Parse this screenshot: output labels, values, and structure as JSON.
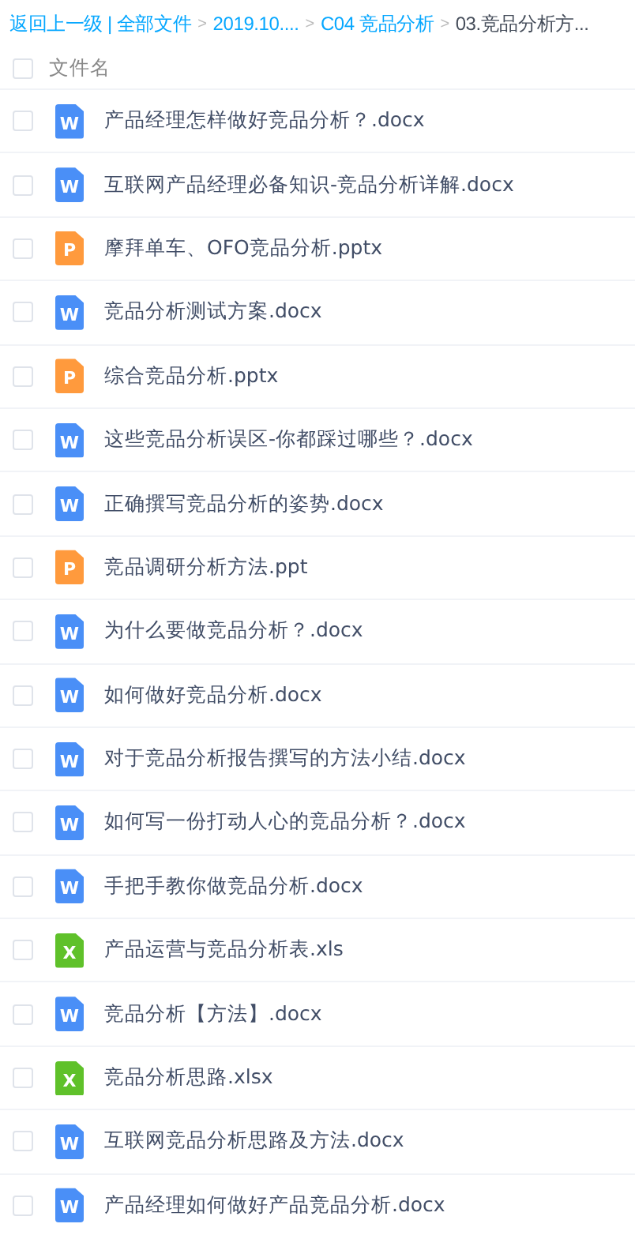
{
  "breadcrumb": [
    {
      "kind": "link",
      "text": "返回上一级"
    },
    {
      "kind": "divider",
      "text": "|"
    },
    {
      "kind": "link",
      "text": "全部文件"
    },
    {
      "kind": "arrow",
      "text": ">"
    },
    {
      "kind": "link",
      "text": "2019.10...."
    },
    {
      "kind": "arrow",
      "text": ">"
    },
    {
      "kind": "link",
      "text": "C04 竞品分析"
    },
    {
      "kind": "arrow",
      "text": ">"
    },
    {
      "kind": "current",
      "text": "03.竞品分析方..."
    }
  ],
  "header": {
    "label": "文件名",
    "checked": false
  },
  "files": [
    {
      "kind": "word",
      "letter": "W",
      "name": "产品经理怎样做好竞品分析？.docx",
      "checked": false
    },
    {
      "kind": "word",
      "letter": "W",
      "name": "互联网产品经理必备知识-竞品分析详解.docx",
      "checked": false
    },
    {
      "kind": "ppt",
      "letter": "P",
      "name": "摩拜单车、OFO竞品分析.pptx",
      "checked": false
    },
    {
      "kind": "word",
      "letter": "W",
      "name": "竞品分析测试方案.docx",
      "checked": false
    },
    {
      "kind": "ppt",
      "letter": "P",
      "name": "综合竞品分析.pptx",
      "checked": false
    },
    {
      "kind": "word",
      "letter": "W",
      "name": "这些竞品分析误区-你都踩过哪些？.docx",
      "checked": false
    },
    {
      "kind": "word",
      "letter": "W",
      "name": "正确撰写竞品分析的姿势.docx",
      "checked": false
    },
    {
      "kind": "ppt",
      "letter": "P",
      "name": "竞品调研分析方法.ppt",
      "checked": false
    },
    {
      "kind": "word",
      "letter": "W",
      "name": "为什么要做竞品分析？.docx",
      "checked": false
    },
    {
      "kind": "word",
      "letter": "W",
      "name": "如何做好竞品分析.docx",
      "checked": false
    },
    {
      "kind": "word",
      "letter": "W",
      "name": "对于竞品分析报告撰写的方法小结.docx",
      "checked": false
    },
    {
      "kind": "word",
      "letter": "W",
      "name": "如何写一份打动人心的竞品分析？.docx",
      "checked": false
    },
    {
      "kind": "word",
      "letter": "W",
      "name": "手把手教你做竞品分析.docx",
      "checked": false
    },
    {
      "kind": "excel",
      "letter": "X",
      "name": "产品运营与竞品分析表.xls",
      "checked": false
    },
    {
      "kind": "word",
      "letter": "W",
      "name": "竞品分析【方法】.docx",
      "checked": false
    },
    {
      "kind": "excel",
      "letter": "X",
      "name": "竞品分析思路.xlsx",
      "checked": false
    },
    {
      "kind": "word",
      "letter": "W",
      "name": "互联网竞品分析思路及方法.docx",
      "checked": false
    },
    {
      "kind": "word",
      "letter": "W",
      "name": "产品经理如何做好产品竞品分析.docx",
      "checked": false
    }
  ]
}
